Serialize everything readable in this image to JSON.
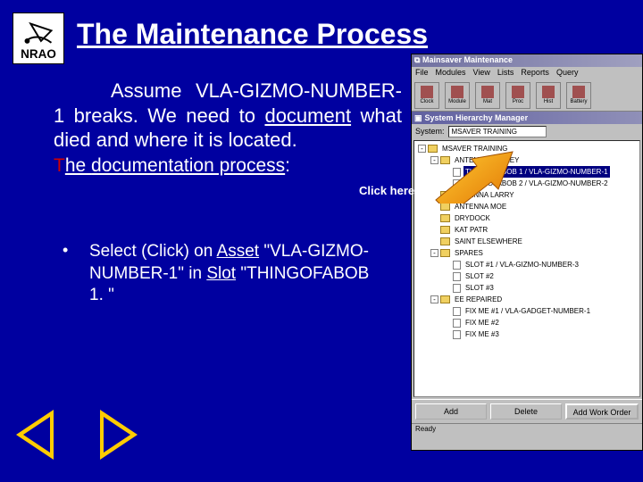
{
  "title": "The Maintenance Process",
  "logo_name": "NRAO",
  "body": {
    "line1_a": "Assume VLA-GIZMO-NUMBER-1 breaks. We need to ",
    "line1_u": "document",
    "line1_b": " what died and where it is located.",
    "proc_a": "T",
    "proc_b": "he ",
    "proc_c": "documentation process",
    "proc_d": ":"
  },
  "click_here": "Click here!",
  "bullet": {
    "a": "Select (Click) on ",
    "asset_u": "Asset",
    "b": " \"VLA-GIZMO-NUMBER-1\" in ",
    "slot_u": "Slot",
    "c": " \"THINGOFABOB 1. \""
  },
  "window": {
    "title": "Mainsaver   Maintenance",
    "menus": [
      "File",
      "Modules",
      "View",
      "Lists",
      "Reports",
      "Query"
    ],
    "toolbar": [
      {
        "icon": "clock",
        "label": "Clock"
      },
      {
        "icon": "grid",
        "label": "Module"
      },
      {
        "icon": "files",
        "label": "Mat"
      },
      {
        "icon": "edit",
        "label": "Proc"
      },
      {
        "icon": "hist",
        "label": "Hist"
      },
      {
        "icon": "bat",
        "label": "Battery"
      }
    ],
    "hierarchy_title": "System Hierarchy Manager",
    "system_label": "System:",
    "system_value": "MSAVER TRAINING",
    "tree": [
      {
        "level": 0,
        "pm": "-",
        "type": "folder",
        "label": "MSAVER TRAINING",
        "sel": false
      },
      {
        "level": 1,
        "pm": "-",
        "type": "folder",
        "label": "ANTENNA CURLEY",
        "sel": false
      },
      {
        "level": 2,
        "pm": "",
        "type": "doc",
        "label": "THINGOFABOB 1 / VLA-GIZMO-NUMBER-1",
        "sel": true
      },
      {
        "level": 2,
        "pm": "",
        "type": "doc",
        "label": "THINGOFABOB 2 / VLA-GIZMO-NUMBER-2",
        "sel": false
      },
      {
        "level": 1,
        "pm": "",
        "type": "folder",
        "label": "ANTENNA LARRY",
        "sel": false
      },
      {
        "level": 1,
        "pm": "",
        "type": "folder",
        "label": "ANTENNA MOE",
        "sel": false
      },
      {
        "level": 1,
        "pm": "",
        "type": "folder",
        "label": "DRYDOCK",
        "sel": false
      },
      {
        "level": 1,
        "pm": "",
        "type": "folder",
        "label": "KAT PATR",
        "sel": false
      },
      {
        "level": 1,
        "pm": "",
        "type": "folder",
        "label": "SAINT ELSEWHERE",
        "sel": false
      },
      {
        "level": 1,
        "pm": "-",
        "type": "folder",
        "label": "SPARES",
        "sel": false
      },
      {
        "level": 2,
        "pm": "",
        "type": "doc",
        "label": "SLOT #1 / VLA-GIZMO-NUMBER-3",
        "sel": false
      },
      {
        "level": 2,
        "pm": "",
        "type": "doc",
        "label": "SLOT #2",
        "sel": false
      },
      {
        "level": 2,
        "pm": "",
        "type": "doc",
        "label": "SLOT #3",
        "sel": false
      },
      {
        "level": 1,
        "pm": "-",
        "type": "folder",
        "label": "EE REPAIRED",
        "sel": false
      },
      {
        "level": 2,
        "pm": "",
        "type": "doc",
        "label": "FIX ME #1 / VLA-GADGET-NUMBER-1",
        "sel": false
      },
      {
        "level": 2,
        "pm": "",
        "type": "doc",
        "label": "FIX ME #2",
        "sel": false
      },
      {
        "level": 2,
        "pm": "",
        "type": "doc",
        "label": "FIX ME #3",
        "sel": false
      }
    ],
    "buttons": {
      "add": "Add",
      "delete": "Delete",
      "addwo": "Add Work Order"
    },
    "status": "Ready"
  }
}
